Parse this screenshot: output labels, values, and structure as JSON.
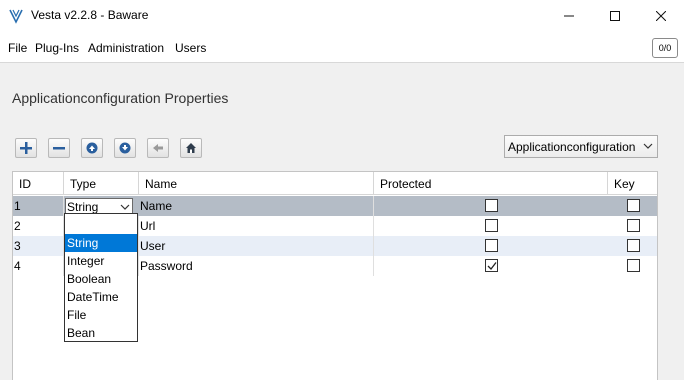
{
  "window": {
    "title": "Vesta v2.2.8 - Baware",
    "controls": {
      "minimize": "—",
      "maximize": "☐",
      "close": "✕"
    }
  },
  "menu": {
    "items": [
      "File",
      "Plug-Ins",
      "Administration",
      "Users"
    ],
    "counter": "0/0"
  },
  "page": {
    "title": "Applicationconfiguration Properties",
    "toolbar": [
      "add-icon",
      "remove-icon",
      "move-up-icon",
      "move-down-icon",
      "back-icon",
      "home-icon"
    ],
    "config_select": "Applicationconfiguration"
  },
  "table": {
    "columns": [
      "ID",
      "Type",
      "Name",
      "Protected",
      "Key"
    ],
    "rows": [
      {
        "id": "1",
        "type": "String",
        "name": "Name",
        "protected": false,
        "key": false
      },
      {
        "id": "2",
        "type": "",
        "name": "Url",
        "protected": false,
        "key": false
      },
      {
        "id": "3",
        "type": "",
        "name": "User",
        "protected": false,
        "key": false
      },
      {
        "id": "4",
        "type": "",
        "name": "Password",
        "protected": true,
        "key": false
      }
    ]
  },
  "type_dropdown": {
    "options": [
      "",
      "String",
      "Integer",
      "Boolean",
      "DateTime",
      "File",
      "Bean"
    ],
    "highlighted": "String"
  },
  "colors": {
    "accent": "#0078d7",
    "selected_row": "#b4bcc6",
    "alt_row": "#e8eef7",
    "toolbar_icon": "#2a5f9e"
  }
}
